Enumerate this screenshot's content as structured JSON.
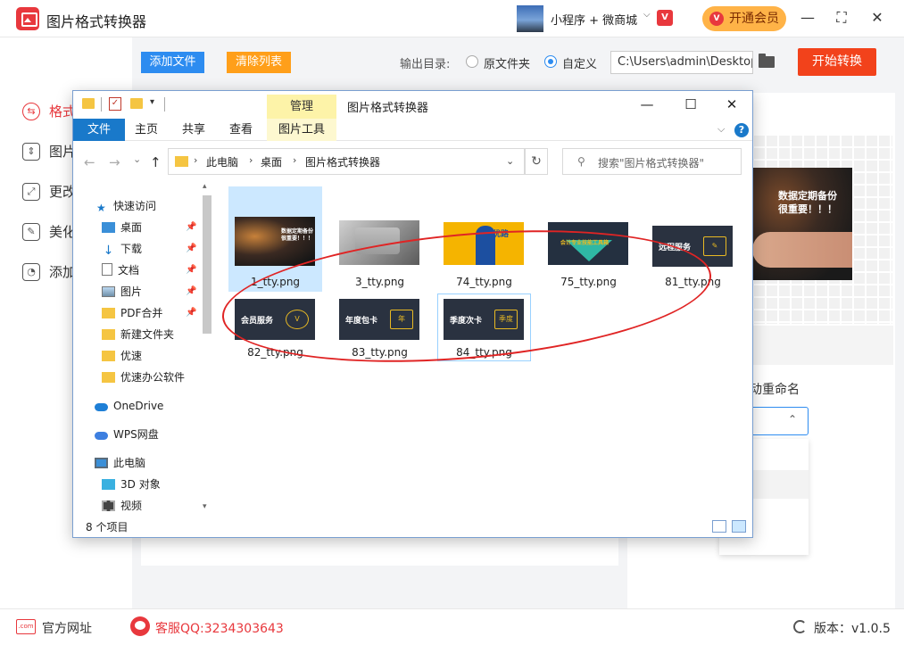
{
  "app": {
    "title": "图片格式转换器",
    "user_name": "小程序 + 微商城",
    "vip_badge": "V",
    "open_vip": "开通会员",
    "controls": {
      "minimize": "—",
      "maximize": "⛶",
      "close": "✕"
    }
  },
  "sidebar": {
    "items": [
      {
        "label": "格式",
        "icon": "convert-icon",
        "icon_glyph": "⇆"
      },
      {
        "label": "图片",
        "icon": "compress-icon",
        "icon_glyph": "⇕"
      },
      {
        "label": "更改",
        "icon": "resize-icon",
        "icon_glyph": "⤢"
      },
      {
        "label": "美化",
        "icon": "beautify-icon",
        "icon_glyph": "✎"
      },
      {
        "label": "添加",
        "icon": "watermark-icon",
        "icon_glyph": "◔"
      }
    ]
  },
  "toolbar": {
    "add_file": "添加文件",
    "clear_list": "清除列表",
    "output_dir_label": "输出目录:",
    "opt_source": "原文件夹",
    "opt_custom": "自定义",
    "selected_option": "自定义",
    "path_value": "C:\\Users\\admin\\Desktop",
    "start": "开始转换"
  },
  "right_panel": {
    "preview_text": "数据定期备份\n很重要！！！",
    "rename_label": "动重命名",
    "rename_caret": "⌃"
  },
  "footer": {
    "site_icon_text": ".com",
    "official_site": "官方网址",
    "qq_service": "客服QQ:3234303643",
    "version": "版本：v1.0.5"
  },
  "explorer": {
    "qa_check": "✓",
    "qa_drop": "▾",
    "manage_tab": "管理",
    "title": "图片格式转换器",
    "controls": {
      "minimize": "—",
      "maximize": "☐",
      "close": "✕"
    },
    "ribbon_tabs": {
      "file": "文件",
      "home": "主页",
      "share": "共享",
      "view": "查看",
      "image_tools": "图片工具"
    },
    "ribbon_collapse": "⌵",
    "help": "?",
    "nav": {
      "back": "←",
      "forward": "→",
      "recent": "⌄",
      "up": "↑"
    },
    "breadcrumb": [
      "此电脑",
      "桌面",
      "图片格式转换器"
    ],
    "breadcrumb_sep": "›",
    "addr_drop": "⌄",
    "refresh": "↻",
    "search_icon": "⚲",
    "search_placeholder": "搜索\"图片格式转换器\"",
    "nav_pane": [
      {
        "label": "快速访问",
        "icon": "star-icon"
      },
      {
        "label": "桌面",
        "icon": "desktop-icon",
        "pinned": true
      },
      {
        "label": "下载",
        "icon": "download-icon",
        "pinned": true
      },
      {
        "label": "文档",
        "icon": "document-icon",
        "pinned": true
      },
      {
        "label": "图片",
        "icon": "picture-icon",
        "pinned": true
      },
      {
        "label": "PDF合并",
        "icon": "folder-icon",
        "pinned": true
      },
      {
        "label": "新建文件夹",
        "icon": "folder-icon"
      },
      {
        "label": "优速",
        "icon": "folder-icon"
      },
      {
        "label": "优速办公软件",
        "icon": "folder-icon"
      },
      {
        "label": "OneDrive",
        "icon": "cloud-icon"
      },
      {
        "label": "WPS网盘",
        "icon": "cloud-icon"
      },
      {
        "label": "此电脑",
        "icon": "computer-icon"
      },
      {
        "label": "3D 对象",
        "icon": "cube-icon"
      },
      {
        "label": "视频",
        "icon": "video-icon"
      }
    ],
    "pin_glyph": "📌",
    "scroll_up": "▴",
    "scroll_down": "▾",
    "files": [
      {
        "name": "1_tty.png",
        "thumb_text": "数据定期备份\n很重要！！！"
      },
      {
        "name": "3_tty.png",
        "thumb_text": ""
      },
      {
        "name": "74_tty.png",
        "thumb_text": "优路"
      },
      {
        "name": "75_tty.png",
        "thumb_text": "会计专业技能工具箱"
      },
      {
        "name": "81_tty.png",
        "thumb_text": "远程服务",
        "box": "✎"
      },
      {
        "name": "82_tty.png",
        "thumb_text": "会员服务",
        "box": "V"
      },
      {
        "name": "83_tty.png",
        "thumb_text": "年度包卡",
        "box": "年"
      },
      {
        "name": "84_tty.png",
        "thumb_text": "季度次卡",
        "box": "季度"
      }
    ],
    "status": "8 个项目"
  },
  "colors": {
    "brand_red": "#e8383d",
    "accent_blue": "#2d8cf0",
    "orange": "#ff9f1a",
    "start_red": "#f2421b",
    "selection_blue": "#cce8ff",
    "annotation_red": "#e02424"
  }
}
